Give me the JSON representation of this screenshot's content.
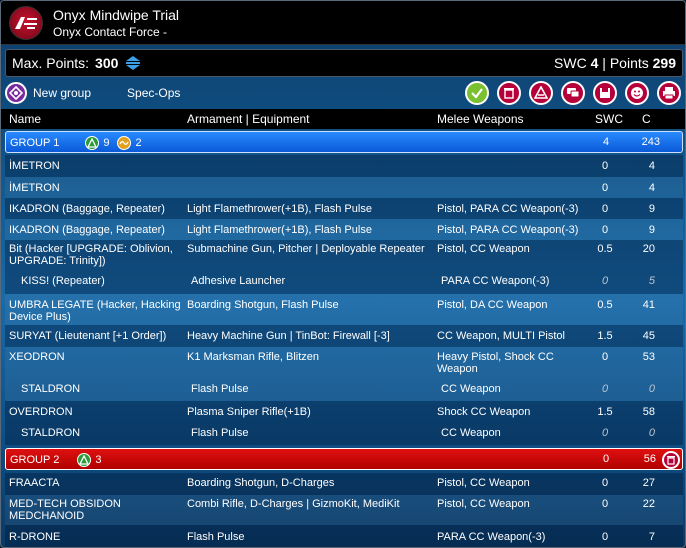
{
  "window": {
    "title": "Onyx Mindwipe Trial",
    "subtitle": "Onyx Contact Force -"
  },
  "points": {
    "max_label": "Max. Points:",
    "max_value": "300",
    "swc_label": "SWC",
    "swc_value": "4",
    "sep": "|",
    "points_label": "Points",
    "points_value": "299"
  },
  "toolbar": {
    "new_group_label": "New group",
    "spec_ops_label": "Spec-Ops",
    "icons": [
      "check-icon",
      "trash-icon",
      "army-icon",
      "chat-icon",
      "save-icon",
      "smiley-icon",
      "print-icon"
    ]
  },
  "columns": {
    "name": "Name",
    "armament": "Armament | Equipment",
    "melee": "Melee Weapons",
    "swc": "SWC",
    "c": "C"
  },
  "groups": [
    {
      "label": "GROUP 1",
      "orders_regular": "9",
      "orders_impetuous": "2",
      "swc": "4",
      "c": "243"
    },
    {
      "label": "GROUP 2",
      "orders_regular": "3",
      "swc": "0",
      "c": "56"
    }
  ],
  "units": [
    {
      "name": "İMETRON",
      "arm": "",
      "melee": "",
      "swc": "0",
      "c": "4"
    },
    {
      "name": "İMETRON",
      "arm": "",
      "melee": "",
      "swc": "0",
      "c": "4"
    },
    {
      "name": "IKADRON (Baggage, Repeater)",
      "arm": "Light Flamethrower(+1B), Flash Pulse",
      "melee": "Pistol, PARA CC Weapon(-3)",
      "swc": "0",
      "c": "9"
    },
    {
      "name": "IKADRON (Baggage, Repeater)",
      "arm": "Light Flamethrower(+1B), Flash Pulse",
      "melee": "Pistol, PARA CC Weapon(-3)",
      "swc": "0",
      "c": "9"
    },
    {
      "name": "Bit (Hacker [UPGRADE: Oblivion, UPGRADE: Trinity])",
      "arm": "Submachine Gun, Pitcher | Deployable Repeater",
      "melee": "Pistol, CC Weapon",
      "swc": "0.5",
      "c": "20"
    },
    {
      "name": "KISS! (Repeater)",
      "arm": "Adhesive Launcher",
      "melee": "PARA CC Weapon(-3)",
      "swc": "0",
      "c": "5"
    },
    {
      "name": "UMBRA LEGATE (Hacker, Hacking Device Plus)",
      "arm": "Boarding Shotgun, Flash Pulse",
      "melee": "Pistol, DA CC Weapon",
      "swc": "0.5",
      "c": "41"
    },
    {
      "name": "SURYAT (Lieutenant [+1 Order])",
      "arm": "Heavy Machine Gun | TinBot: Firewall [-3]",
      "melee": "CC Weapon, MULTI Pistol",
      "swc": "1.5",
      "c": "45"
    },
    {
      "name": "XEODRON",
      "arm": "K1 Marksman Rifle, Blitzen",
      "melee": "Heavy Pistol, Shock CC Weapon",
      "swc": "0",
      "c": "53"
    },
    {
      "name": "STALDRON",
      "arm": "Flash Pulse",
      "melee": "CC Weapon",
      "swc": "0",
      "c": "0"
    },
    {
      "name": "OVERDRON",
      "arm": "Plasma Sniper Rifle(+1B)",
      "melee": "Shock CC Weapon",
      "swc": "1.5",
      "c": "58"
    },
    {
      "name": "STALDRON",
      "arm": "Flash Pulse",
      "melee": "CC Weapon",
      "swc": "0",
      "c": "0"
    },
    {
      "name": "FRAACTA",
      "arm": "Boarding Shotgun, D-Charges",
      "melee": "Pistol, CC Weapon",
      "swc": "0",
      "c": "27"
    },
    {
      "name": "MED-TECH OBSIDON MEDCHANOID",
      "arm": "Combi Rifle, D-Charges | GizmoKit, MediKit",
      "melee": "Pistol, CC Weapon",
      "swc": "0",
      "c": "22"
    },
    {
      "name": "R-DRONE",
      "arm": "Flash Pulse",
      "melee": "PARA CC Weapon(-3)",
      "swc": "0",
      "c": "7"
    }
  ],
  "colors": {
    "group1": "#1a6ff0",
    "group2": "#d00000",
    "regular_order": "#2a9a3a",
    "impetuous_order": "#e0a020",
    "button_magenta": "#b5003a",
    "button_purple": "#7a2a9a",
    "check_green": "#7ac030"
  }
}
